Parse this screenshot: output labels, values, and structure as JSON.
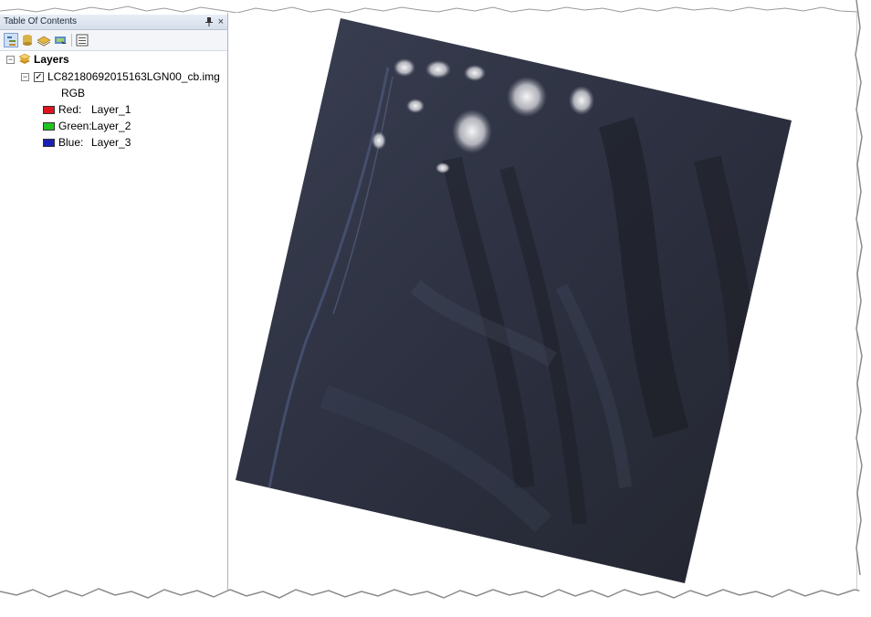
{
  "toc": {
    "title": "Table Of Contents",
    "pin_icon": "pin-icon",
    "close_glyph": "×"
  },
  "toolbar": {
    "buttons": [
      "list-by-drawing-order-icon",
      "list-by-source-icon",
      "list-by-visibility-icon",
      "list-by-selection-icon",
      "options-icon"
    ]
  },
  "layers": {
    "root_label": "Layers",
    "items": [
      {
        "name": "LC82180692015163LGN00_cb.img",
        "checked": true,
        "renderer": "RGB",
        "bands": [
          {
            "channel": "Red:",
            "band": "Layer_1",
            "color": "#e0141e"
          },
          {
            "channel": "Green:",
            "band": "Layer_2",
            "color": "#22c322"
          },
          {
            "channel": "Blue:",
            "band": "Layer_3",
            "color": "#1a20b4"
          }
        ]
      }
    ]
  },
  "map": {
    "background": "#ffffff",
    "raster_tone": "#2b2f3d"
  }
}
